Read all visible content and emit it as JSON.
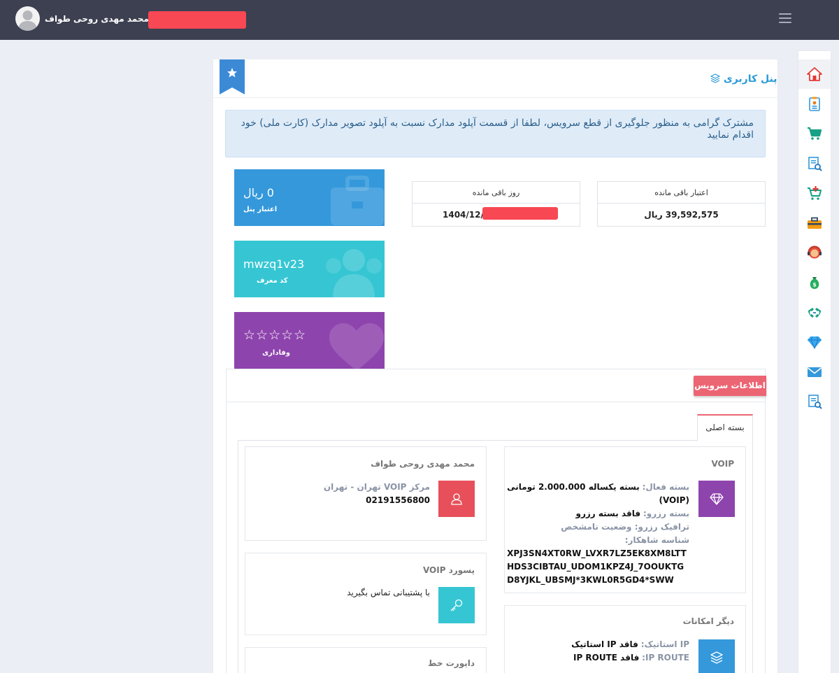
{
  "header": {
    "user_name": "محمد مهدی روحی طواف",
    "menu_icon": "hamburger-icon"
  },
  "sidebar": {
    "items": [
      {
        "icon": "home-icon"
      },
      {
        "icon": "profile-card-icon"
      },
      {
        "icon": "cart-icon"
      },
      {
        "icon": "invoice-search-icon"
      },
      {
        "icon": "cart-add-icon"
      },
      {
        "icon": "toolbox-icon"
      },
      {
        "icon": "support-agent-icon"
      },
      {
        "icon": "money-bag-icon"
      },
      {
        "icon": "phone-transfer-icon"
      },
      {
        "icon": "diamond-icon"
      },
      {
        "icon": "mail-icon"
      },
      {
        "icon": "report-search-icon"
      }
    ]
  },
  "panel": {
    "title": "پنل کاربری",
    "alert": "مشترک گرامی به منظور جلوگیری از قطع سرویس، لطفا از قسمت آپلود مدارک نسبت به آپلود تصویر مدارک (کارت ملی) خود اقدام نمایید"
  },
  "stats": {
    "credit_label": "اعتبار باقی مانده",
    "credit_value": "39,592,575 ریال",
    "days_label": "روز باقی مانده",
    "days_value": "1404/12/"
  },
  "tiles": {
    "panel_credit_value": "0 ریال",
    "panel_credit_label": "اعتبار پنل",
    "referral_code_value": "mwzq1v23",
    "referral_code_label": "کد معرف",
    "loyalty_stars": "☆☆☆☆☆",
    "loyalty_label": "وفاداری"
  },
  "service": {
    "badge": "اطلاعات سرویس",
    "tab_label": "بسته اصلی",
    "voip_box": {
      "title": "VOIP",
      "active_label": "بسته فعال:",
      "active_value": "بسته یکساله 2.000.000 تومانی",
      "active_value_suffix": "(VOIP)",
      "reserve_label": "بسته رزرو:",
      "reserve_value": "فاقد بسته رزرو",
      "traffic_label": "ترافیک رزرو:",
      "traffic_value": "وضعیت نامشخص",
      "id_label": "شناسه شاهکار:",
      "id_lines": [
        "XPJ3SN4XT0RW_LVXR7LZ5EK8XM8LTT",
        "HDS3CIBTAU_UDOM1KPZ4J_7OOUKTG",
        "D8YJKL_UBSMJ*3KWL0R5GD4*SWW"
      ]
    },
    "owner_box": {
      "title": "محمد مهدی روحی طواف",
      "center": "مرکز VOIP تهران - تهران",
      "phone": "02191556800"
    },
    "password_box": {
      "title": "پسورد VOIP",
      "text": "با پشتیبانی تماس بگیرید"
    },
    "features_box": {
      "title": "دیگر امکانات",
      "static_label": "IP استاتیک:",
      "static_value": "فاقد IP استاتیک",
      "route_label": "IP ROUTE:",
      "route_value": "فاقد IP ROUTE"
    },
    "divert_box": {
      "title": "دایورت خط"
    }
  },
  "colors": {
    "topbar": "#3d4051",
    "accent_blue": "#2a9ad8",
    "tile_blue": "#3498db",
    "tile_teal": "#36c6d3",
    "tile_purple": "#8e44ad",
    "badge_red": "#ec6573"
  }
}
